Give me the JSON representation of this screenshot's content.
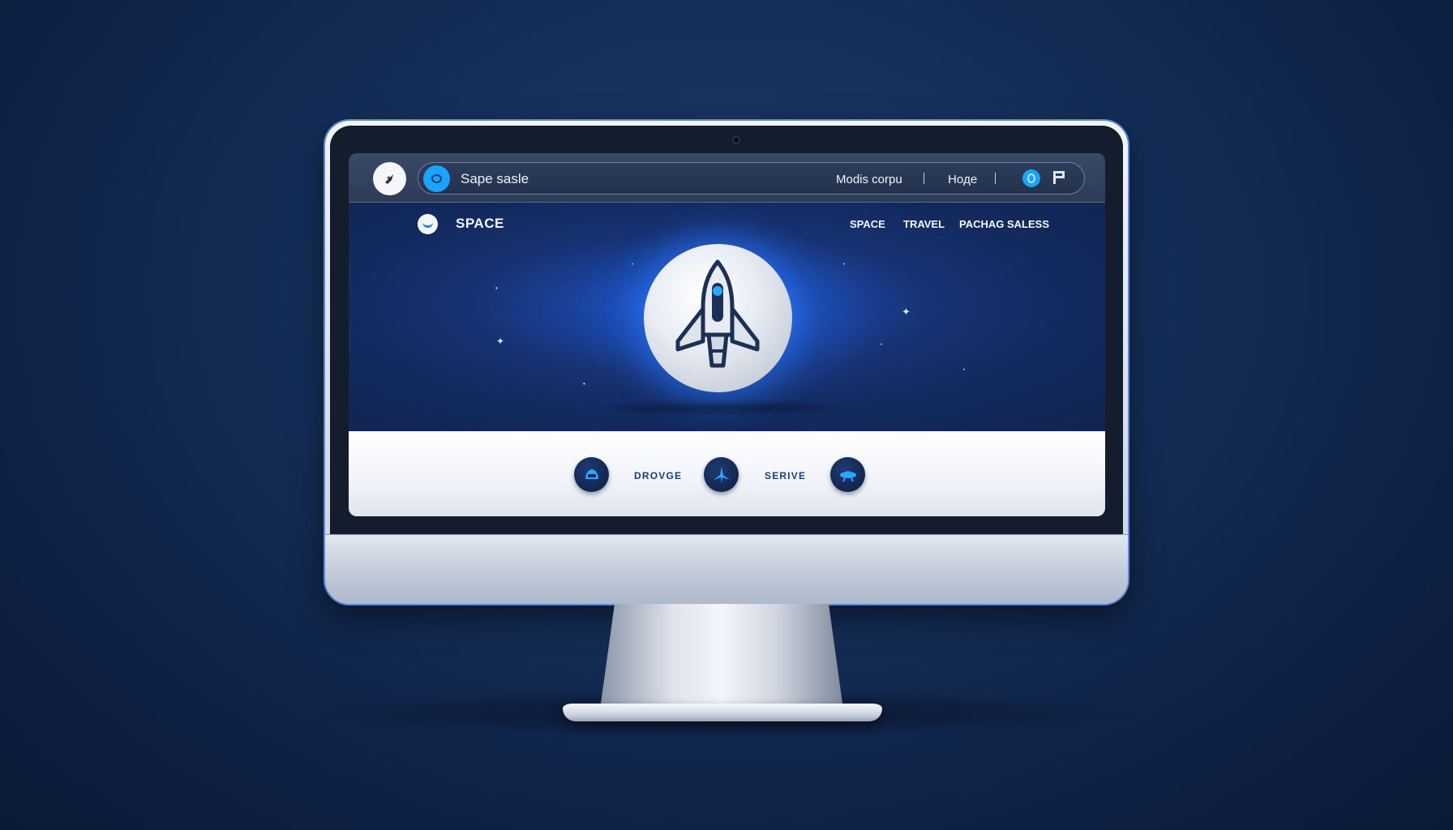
{
  "browser": {
    "tab_icon": "rocket-icon",
    "address_text": "Sape sasle",
    "links": [
      "Modis corpu",
      "Hoде"
    ]
  },
  "site": {
    "name": "SPACE",
    "nav": [
      "SPACE",
      "TRAVEL",
      "PACНAG SALESS"
    ]
  },
  "hero": {
    "image": "rocket-icon"
  },
  "services": [
    {
      "icon": "helmet-icon"
    },
    {
      "label": "DROVGE"
    },
    {
      "icon": "plane-icon"
    },
    {
      "label": "SERIVE"
    },
    {
      "icon": "ufo-icon"
    }
  ],
  "colors": {
    "accent": "#1aa3ff",
    "navy": "#13264f",
    "background": "#132a5e"
  }
}
